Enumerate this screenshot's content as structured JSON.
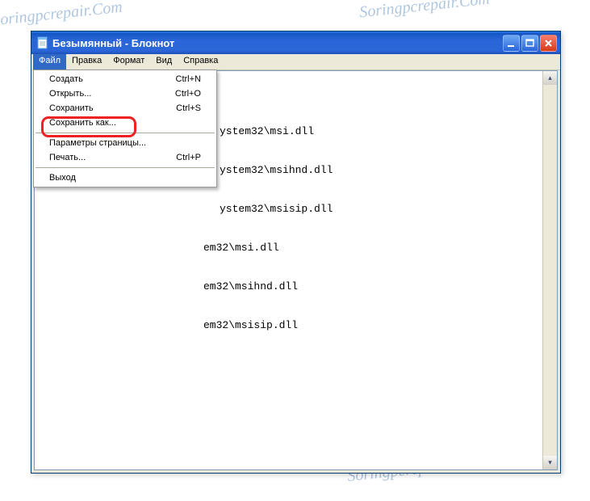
{
  "watermark": "Soringpcrepair.Com",
  "window": {
    "title": "Безымянный - Блокнот"
  },
  "menubar": {
    "file": "Файл",
    "edit": "Правка",
    "format": "Формат",
    "view": "Вид",
    "help": "Справка"
  },
  "file_menu": {
    "new": {
      "label": "Создать",
      "shortcut": "Ctrl+N"
    },
    "open": {
      "label": "Открыть...",
      "shortcut": "Ctrl+O"
    },
    "save": {
      "label": "Сохранить",
      "shortcut": "Ctrl+S"
    },
    "save_as": {
      "label": "Сохранить как...",
      "shortcut": ""
    },
    "page_setup": {
      "label": "Параметры страницы...",
      "shortcut": ""
    },
    "print": {
      "label": "Печать...",
      "shortcut": "Ctrl+P"
    },
    "exit": {
      "label": "Выход",
      "shortcut": ""
    }
  },
  "editor": {
    "lines": [
      "ystem32\\msi.dll",
      "ystem32\\msihnd.dll",
      "ystem32\\msisip.dll",
      "em32\\msi.dll",
      "em32\\msihnd.dll",
      "em32\\msisip.dll"
    ]
  }
}
